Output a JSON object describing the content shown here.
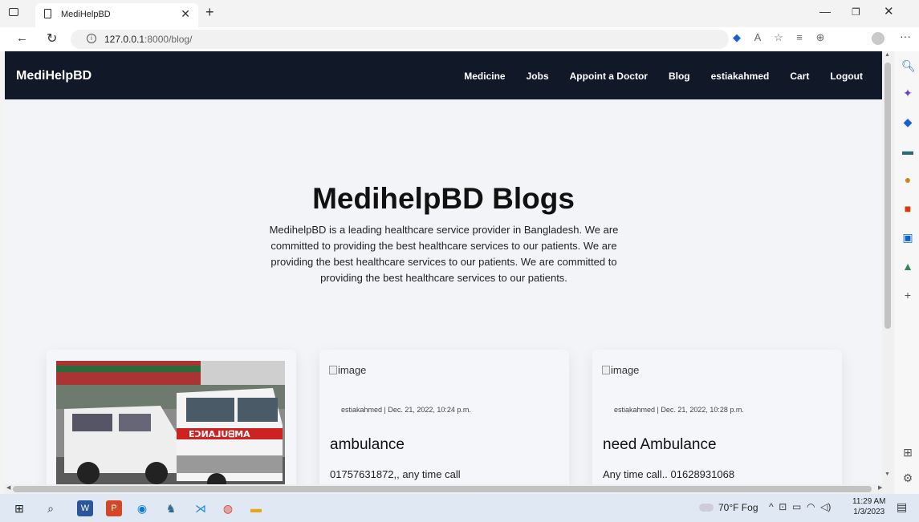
{
  "browser": {
    "tab_title": "MediHelpBD",
    "url_host": "127.0.0.1",
    "url_path": ":8000/blog/"
  },
  "site": {
    "brand": "MediHelpBD",
    "menu": [
      "Medicine",
      "Jobs",
      "Appoint a Doctor",
      "Blog",
      "estiakahmed",
      "Cart",
      "Logout"
    ]
  },
  "hero": {
    "title": "MedihelpBD Blogs",
    "text": "MedihelpBD is a leading healthcare service provider in Bangladesh. We are committed to providing the best healthcare services to our patients. We are providing the best healthcare services to our patients. We are committed to providing the best healthcare services to our patients."
  },
  "cards": [
    {
      "image_alt": "image",
      "meta": "",
      "title": "",
      "text": ""
    },
    {
      "image_alt": "image",
      "meta": "estiakahmed | Dec. 21, 2022, 10:24 p.m.",
      "title": "ambulance",
      "text": "01757631872,, any time call"
    },
    {
      "image_alt": "image",
      "meta": "estiakahmed | Dec. 21, 2022, 10:28 p.m.",
      "title": "need Ambulance",
      "text": "Any time call.. 01628931068"
    }
  ],
  "taskbar": {
    "weather": "70°F  Fog",
    "time": "11:29 AM",
    "date": "1/3/2023"
  },
  "colors": {
    "site_nav_bg": "#111827",
    "page_bg": "#f2f4f8"
  }
}
